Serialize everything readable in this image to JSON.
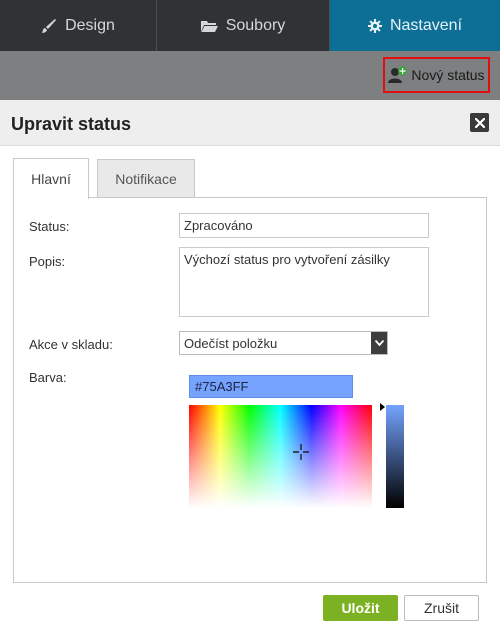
{
  "topnav": {
    "tabs": [
      {
        "label": "Design",
        "icon": "brush-icon"
      },
      {
        "label": "Soubory",
        "icon": "folder-icon"
      },
      {
        "label": "Nastavení",
        "icon": "gear-icon",
        "active": true
      }
    ]
  },
  "toolbar": {
    "new_status_label": "Nový status"
  },
  "modal": {
    "title": "Upravit status",
    "tabs": [
      {
        "label": "Hlavní",
        "active": true
      },
      {
        "label": "Notifikace",
        "active": false
      }
    ],
    "form": {
      "status_label": "Status:",
      "status_value": "Zpracováno",
      "popis_label": "Popis:",
      "popis_value": "Výchozí status pro vytvoření zásilky",
      "akce_label": "Akce v skladu:",
      "akce_value": "Odečíst položku",
      "barva_label": "Barva:",
      "barva_value": "#75A3FF"
    },
    "buttons": {
      "save": "Uložit",
      "cancel": "Zrušit"
    }
  },
  "colors": {
    "accent_tab": "#0e6f96",
    "save_button": "#7db124",
    "highlight_border": "#e01010",
    "selected_color": "#75A3FF"
  }
}
